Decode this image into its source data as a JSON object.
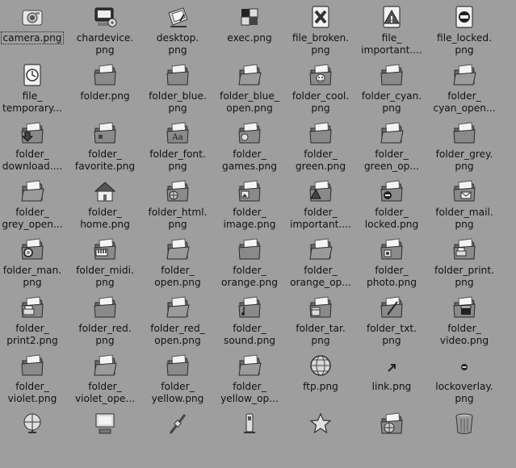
{
  "file_view": {
    "items": [
      {
        "label": "camera.png",
        "icon": "camera-icon",
        "selected": true
      },
      {
        "label": "chardevice.\npng",
        "icon": "chardevice-icon"
      },
      {
        "label": "desktop.\npng",
        "icon": "desktop-icon"
      },
      {
        "label": "exec.png",
        "icon": "exec-icon"
      },
      {
        "label": "file_broken.\npng",
        "icon": "file-broken-icon"
      },
      {
        "label": "file_\nimportant....",
        "icon": "file-important-icon"
      },
      {
        "label": "file_locked.\npng",
        "icon": "file-locked-icon"
      },
      {
        "label": "file_\ntemporary...",
        "icon": "file-temporary-icon"
      },
      {
        "label": "folder.png",
        "icon": "folder-icon"
      },
      {
        "label": "folder_blue.\npng",
        "icon": "folder-blue-icon"
      },
      {
        "label": "folder_blue_\nopen.png",
        "icon": "folder-blue-open-icon"
      },
      {
        "label": "folder_cool.\npng",
        "icon": "folder-cool-icon"
      },
      {
        "label": "folder_cyan.\npng",
        "icon": "folder-cyan-icon"
      },
      {
        "label": "folder_\ncyan_open...",
        "icon": "folder-cyan-open-icon"
      },
      {
        "label": "folder_\ndownload....",
        "icon": "folder-download-icon"
      },
      {
        "label": "folder_\nfavorite.png",
        "icon": "folder-favorite-icon"
      },
      {
        "label": "folder_font.\npng",
        "icon": "folder-font-icon"
      },
      {
        "label": "folder_\ngames.png",
        "icon": "folder-games-icon"
      },
      {
        "label": "folder_\ngreen.png",
        "icon": "folder-green-icon"
      },
      {
        "label": "folder_\ngreen_op...",
        "icon": "folder-green-open-icon"
      },
      {
        "label": "folder_grey.\npng",
        "icon": "folder-grey-icon"
      },
      {
        "label": "folder_\ngrey_open...",
        "icon": "folder-grey-open-icon"
      },
      {
        "label": "folder_\nhome.png",
        "icon": "folder-home-icon"
      },
      {
        "label": "folder_html.\npng",
        "icon": "folder-html-icon"
      },
      {
        "label": "folder_\nimage.png",
        "icon": "folder-image-icon"
      },
      {
        "label": "folder_\nimportant....",
        "icon": "folder-important-icon"
      },
      {
        "label": "folder_\nlocked.png",
        "icon": "folder-locked-icon"
      },
      {
        "label": "folder_mail.\npng",
        "icon": "folder-mail-icon"
      },
      {
        "label": "folder_man.\npng",
        "icon": "folder-man-icon"
      },
      {
        "label": "folder_midi.\npng",
        "icon": "folder-midi-icon"
      },
      {
        "label": "folder_\nopen.png",
        "icon": "folder-open-icon"
      },
      {
        "label": "folder_\norange.png",
        "icon": "folder-orange-icon"
      },
      {
        "label": "folder_\norange_op...",
        "icon": "folder-orange-open-icon"
      },
      {
        "label": "folder_\nphoto.png",
        "icon": "folder-photo-icon"
      },
      {
        "label": "folder_print.\npng",
        "icon": "folder-print-icon"
      },
      {
        "label": "folder_\nprint2.png",
        "icon": "folder-print2-icon"
      },
      {
        "label": "folder_red.\npng",
        "icon": "folder-red-icon"
      },
      {
        "label": "folder_red_\nopen.png",
        "icon": "folder-red-open-icon"
      },
      {
        "label": "folder_\nsound.png",
        "icon": "folder-sound-icon"
      },
      {
        "label": "folder_tar.\npng",
        "icon": "folder-tar-icon"
      },
      {
        "label": "folder_txt.\npng",
        "icon": "folder-txt-icon"
      },
      {
        "label": "folder_\nvideo.png",
        "icon": "folder-video-icon"
      },
      {
        "label": "folder_\nviolet.png",
        "icon": "folder-violet-icon"
      },
      {
        "label": "folder_\nviolet_ope...",
        "icon": "folder-violet-open-icon"
      },
      {
        "label": "folder_\nyellow.png",
        "icon": "folder-yellow-icon"
      },
      {
        "label": "folder_\nyellow_op...",
        "icon": "folder-yellow-open-icon"
      },
      {
        "label": "ftp.png",
        "icon": "ftp-icon"
      },
      {
        "label": "link.png",
        "icon": "link-icon"
      },
      {
        "label": "lockoverlay.\npng",
        "icon": "lockoverlay-icon"
      },
      {
        "label": "",
        "icon": "network-globe-icon"
      },
      {
        "label": "",
        "icon": "computer-icon"
      },
      {
        "label": "",
        "icon": "connector-icon"
      },
      {
        "label": "",
        "icon": "usb-drive-icon"
      },
      {
        "label": "",
        "icon": "star-icon"
      },
      {
        "label": "",
        "icon": "network-folder-icon"
      },
      {
        "label": "",
        "icon": "trash-can-icon"
      }
    ]
  }
}
